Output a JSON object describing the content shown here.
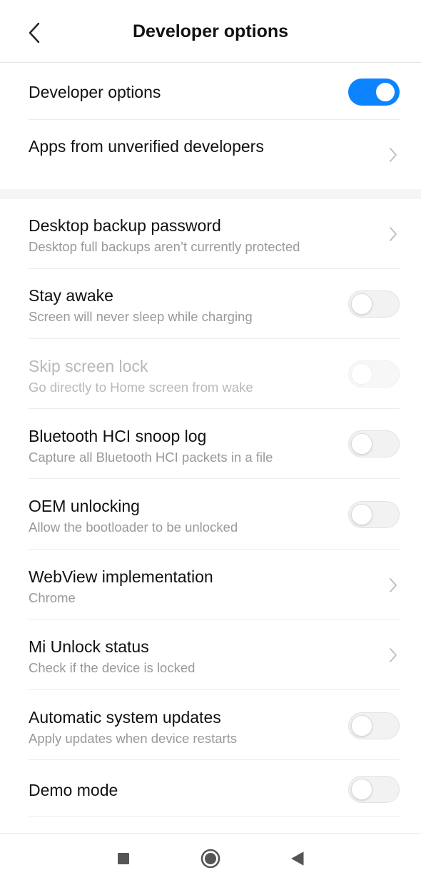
{
  "header": {
    "title": "Developer options",
    "back_icon": "chevron-left-icon"
  },
  "rows": [
    {
      "title": "Developer options",
      "control": "toggle",
      "state": "on"
    },
    {
      "title": "Apps from unverified developers",
      "control": "chevron"
    },
    {
      "title": "Desktop backup password",
      "subtitle": "Desktop full backups aren’t currently protected",
      "control": "chevron"
    },
    {
      "title": "Stay awake",
      "subtitle": "Screen will never sleep while charging",
      "control": "toggle",
      "state": "off"
    },
    {
      "title": "Skip screen lock",
      "subtitle": "Go directly to Home screen from wake",
      "control": "toggle",
      "state": "off",
      "disabled": true
    },
    {
      "title": "Bluetooth HCI snoop log",
      "subtitle": "Capture all Bluetooth HCI packets in a file",
      "control": "toggle",
      "state": "off"
    },
    {
      "title": "OEM unlocking",
      "subtitle": "Allow the bootloader to be unlocked",
      "control": "toggle",
      "state": "off"
    },
    {
      "title": "WebView implementation",
      "subtitle": "Chrome",
      "control": "chevron"
    },
    {
      "title": "Mi Unlock status",
      "subtitle": "Check if the device is locked",
      "control": "chevron"
    },
    {
      "title": "Automatic system updates",
      "subtitle": "Apply updates when device restarts",
      "control": "toggle",
      "state": "off"
    },
    {
      "title": "Demo mode",
      "control": "toggle",
      "state": "off"
    }
  ],
  "colors": {
    "accent": "#0d84ff",
    "text": "#111111",
    "subtext": "#999999",
    "disabled_text": "#b8b8b8"
  },
  "navbar": {
    "icons": [
      "square-recents-icon",
      "circle-home-icon",
      "triangle-back-icon"
    ]
  }
}
